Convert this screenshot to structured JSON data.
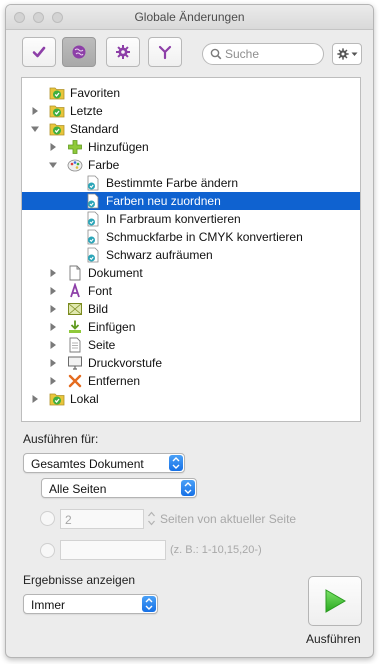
{
  "window": {
    "title": "Globale Änderungen"
  },
  "toolbar": {
    "buttons": [
      {
        "icon": "checkmark-icon"
      },
      {
        "icon": "globe-icon",
        "active": true
      },
      {
        "icon": "gear-icon"
      },
      {
        "icon": "fork-icon"
      }
    ],
    "search_placeholder": "Suche"
  },
  "tree": {
    "items": [
      {
        "label": "Favoriten",
        "icon": "folder-green-icon",
        "level": 0,
        "arrow": "none"
      },
      {
        "label": "Letzte",
        "icon": "folder-green-icon",
        "level": 0,
        "arrow": "right"
      },
      {
        "label": "Standard",
        "icon": "folder-green-icon",
        "level": 0,
        "arrow": "down"
      },
      {
        "label": "Hinzufügen",
        "icon": "plus-icon",
        "level": 1,
        "arrow": "right"
      },
      {
        "label": "Farbe",
        "icon": "palette-icon",
        "level": 1,
        "arrow": "down"
      },
      {
        "label": "Bestimmte Farbe ändern",
        "icon": "document-action-icon",
        "level": 2,
        "arrow": "none"
      },
      {
        "label": "Farben neu zuordnen",
        "icon": "document-action-icon",
        "level": 2,
        "arrow": "none",
        "selected": true
      },
      {
        "label": "In Farbraum konvertieren",
        "icon": "document-action-icon",
        "level": 2,
        "arrow": "none"
      },
      {
        "label": "Schmuckfarbe in CMYK konvertieren",
        "icon": "document-action-icon",
        "level": 2,
        "arrow": "none"
      },
      {
        "label": "Schwarz aufräumen",
        "icon": "document-action-icon",
        "level": 2,
        "arrow": "none"
      },
      {
        "label": "Dokument",
        "icon": "document-icon",
        "level": 1,
        "arrow": "right"
      },
      {
        "label": "Font",
        "icon": "font-icon",
        "level": 1,
        "arrow": "right"
      },
      {
        "label": "Bild",
        "icon": "image-icon",
        "level": 1,
        "arrow": "right"
      },
      {
        "label": "Einfügen",
        "icon": "insert-icon",
        "level": 1,
        "arrow": "right"
      },
      {
        "label": "Seite",
        "icon": "page-icon",
        "level": 1,
        "arrow": "right"
      },
      {
        "label": "Druckvorstufe",
        "icon": "monitor-icon",
        "level": 1,
        "arrow": "right"
      },
      {
        "label": "Entfernen",
        "icon": "remove-x-icon",
        "level": 1,
        "arrow": "right"
      },
      {
        "label": "Lokal",
        "icon": "folder-green-icon",
        "level": 0,
        "arrow": "right"
      }
    ]
  },
  "run_for": {
    "label": "Ausführen für:",
    "scope_value": "Gesamtes Dokument",
    "pages_value": "Alle Seiten",
    "relative_count": "2",
    "relative_suffix": "Seiten von aktueller Seite",
    "range_hint": "(z. B.: 1-10,15,20-)"
  },
  "results": {
    "label": "Ergebnisse anzeigen",
    "value": "Immer"
  },
  "run_button": {
    "label": "Ausführen"
  },
  "colors": {
    "selection": "#0f62d0",
    "run_arrow": "#3cc62c",
    "folder_green": "#3fae3f"
  }
}
